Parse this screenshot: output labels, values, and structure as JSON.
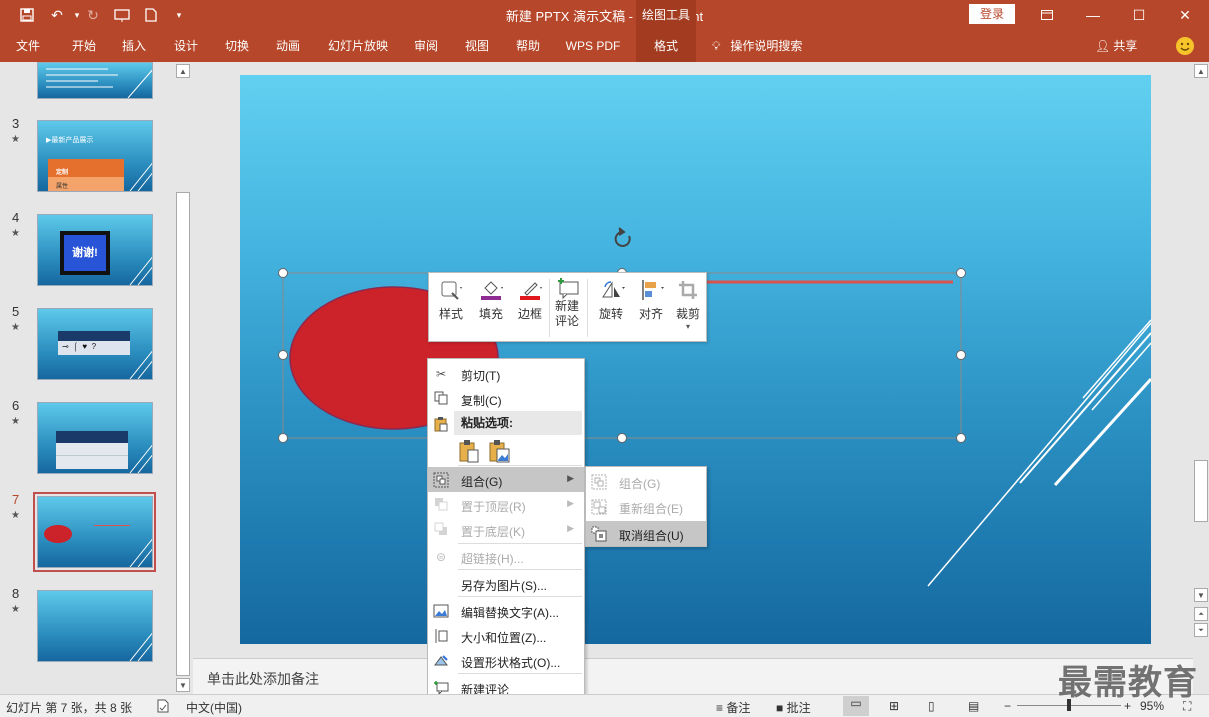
{
  "window": {
    "title": "新建 PPTX 演示文稿  -  PowerPoint",
    "context_tab_group": "绘图工具",
    "login_label": "登录",
    "min_icon": "minimize-icon",
    "max_icon": "maximize-icon",
    "close_icon": "close-icon"
  },
  "ribbon": {
    "tabs": [
      {
        "label": "文件"
      },
      {
        "label": "开始"
      },
      {
        "label": "插入"
      },
      {
        "label": "设计"
      },
      {
        "label": "切换"
      },
      {
        "label": "动画"
      },
      {
        "label": "幻灯片放映"
      },
      {
        "label": "审阅"
      },
      {
        "label": "视图"
      },
      {
        "label": "帮助"
      },
      {
        "label": "WPS PDF"
      },
      {
        "label": "格式"
      }
    ],
    "active_tab": "格式",
    "search_label": "操作说明搜索",
    "share_label": "共享"
  },
  "thumbnails": [
    {
      "num": "3",
      "star": "★",
      "title_text": "▶最新产品展示",
      "table_label_1": "定制",
      "table_label_2": "属性"
    },
    {
      "num": "4",
      "star": "★",
      "thank_text": "谢谢!"
    },
    {
      "num": "5",
      "star": "★",
      "symbols": "⊸  ⌠  ♥  ?"
    },
    {
      "num": "6",
      "star": "★"
    },
    {
      "num": "7",
      "star": "★",
      "selected": true
    },
    {
      "num": "8",
      "star": "★"
    }
  ],
  "notes_placeholder": "单击此处添加备注",
  "mini_toolbar": {
    "style": "样式",
    "fill": "填充",
    "border": "边框",
    "new_comment_1": "新建",
    "new_comment_2": "评论",
    "rotate": "旋转",
    "align": "对齐",
    "crop": "裁剪"
  },
  "context_menu": {
    "cut": "剪切(T)",
    "copy": "复制(C)",
    "paste_options": "粘贴选项:",
    "group": "组合(G)",
    "bring_front": "置于顶层(R)",
    "send_back": "置于底层(K)",
    "hyperlink": "超链接(H)...",
    "save_as_picture": "另存为图片(S)...",
    "edit_alt_text": "编辑替换文字(A)...",
    "size_position": "大小和位置(Z)...",
    "format_shape": "设置形状格式(O)...",
    "new_comment": "新建评论"
  },
  "submenu": {
    "group": "组合(G)",
    "regroup": "重新组合(E)",
    "ungroup": "取消组合(U)"
  },
  "status": {
    "slide_info": "幻灯片 第 7 张，共 8 张",
    "language": "中文(中国)",
    "notes_label": "备注",
    "comments_label": "批注",
    "zoom": "95%",
    "zoom_fraction": 0.5
  },
  "watermark": "最需教育",
  "colors": {
    "accent": "#b7472a",
    "ellipse": "#cc2229",
    "line": "#d9534f"
  }
}
